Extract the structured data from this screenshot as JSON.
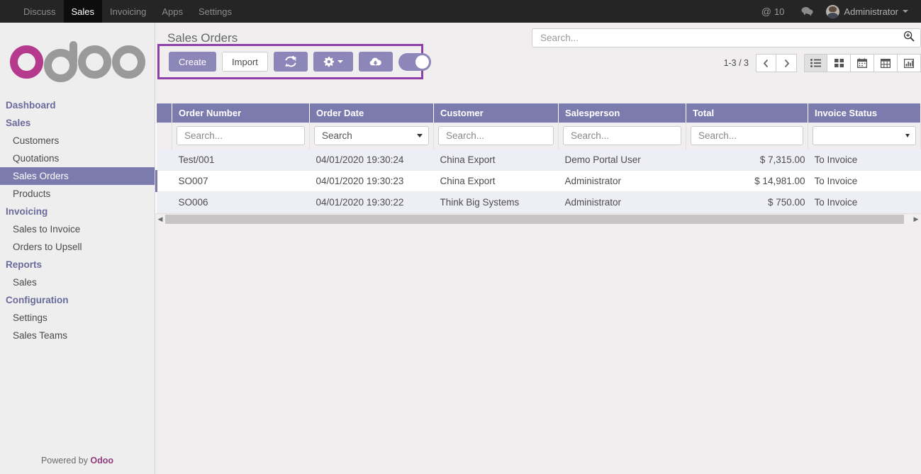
{
  "navbar": {
    "menus": [
      {
        "label": "Discuss",
        "active": false
      },
      {
        "label": "Sales",
        "active": true
      },
      {
        "label": "Invoicing",
        "active": false
      },
      {
        "label": "Apps",
        "active": false
      },
      {
        "label": "Settings",
        "active": false
      }
    ],
    "mention_symbol": "@",
    "mention_count": "10",
    "chat_icon": "chat-bubble-icon",
    "user_name": "Administrator",
    "avatar_icon": "user-avatar"
  },
  "sidebar": {
    "logo_text": "odoo",
    "logo_accent_color": "#b5398d",
    "logo_gray_color": "#9a9a9a",
    "sections": [
      {
        "heading": "Dashboard",
        "is_heading_only": true,
        "items": []
      },
      {
        "heading": "Sales",
        "items": [
          {
            "label": "Customers",
            "active": false
          },
          {
            "label": "Quotations",
            "active": false
          },
          {
            "label": "Sales Orders",
            "active": true
          },
          {
            "label": "Products",
            "active": false
          }
        ]
      },
      {
        "heading": "Invoicing",
        "items": [
          {
            "label": "Sales to Invoice",
            "active": false
          },
          {
            "label": "Orders to Upsell",
            "active": false
          }
        ]
      },
      {
        "heading": "Reports",
        "items": [
          {
            "label": "Sales",
            "active": false
          }
        ]
      },
      {
        "heading": "Configuration",
        "items": [
          {
            "label": "Settings",
            "active": false
          },
          {
            "label": "Sales Teams",
            "active": false
          }
        ]
      }
    ],
    "footer_prefix": "Powered by ",
    "footer_brand": "Odoo"
  },
  "control_panel": {
    "title": "Sales Orders",
    "highlight_color": "#8e3fa8",
    "buttons": [
      {
        "name": "create-button",
        "label": "Create",
        "style": "primary"
      },
      {
        "name": "import-button",
        "label": "Import",
        "style": "white"
      },
      {
        "name": "refresh-button",
        "icon": "refresh-icon",
        "style": "icon"
      },
      {
        "name": "settings-button",
        "icon": "gear-icon",
        "style": "icon-caret"
      },
      {
        "name": "download-button",
        "icon": "cloud-download-icon",
        "style": "icon"
      },
      {
        "name": "mode-toggle",
        "icon": "toggle-switch",
        "state": "on"
      }
    ],
    "search": {
      "placeholder": "Search...",
      "value": "",
      "icon": "search-zoom-in-icon"
    },
    "pager": "1-3 / 3",
    "prev_icon": "chevron-left-icon",
    "next_icon": "chevron-right-icon",
    "views": [
      {
        "name": "list-view-button",
        "icon": "list-icon",
        "active": true
      },
      {
        "name": "kanban-view-button",
        "icon": "kanban-icon",
        "active": false
      },
      {
        "name": "calendar-view-button",
        "icon": "calendar-icon",
        "active": false
      },
      {
        "name": "pivot-view-button",
        "icon": "pivot-table-icon",
        "active": false
      },
      {
        "name": "graph-view-button",
        "icon": "bar-chart-icon",
        "active": false
      }
    ]
  },
  "table": {
    "columns": [
      {
        "key": "order_number",
        "label": "Order Number",
        "filter_type": "input",
        "filter_placeholder": "Search...",
        "align": "left"
      },
      {
        "key": "order_date",
        "label": "Order Date",
        "filter_type": "select",
        "filter_value": "Search",
        "align": "left"
      },
      {
        "key": "customer",
        "label": "Customer",
        "filter_type": "input",
        "filter_placeholder": "Search...",
        "align": "left"
      },
      {
        "key": "salesperson",
        "label": "Salesperson",
        "filter_type": "input",
        "filter_placeholder": "Search...",
        "align": "left"
      },
      {
        "key": "total",
        "label": "Total",
        "filter_type": "input",
        "filter_placeholder": "Search...",
        "align": "right"
      },
      {
        "key": "invoice_status",
        "label": "Invoice Status",
        "filter_type": "select",
        "filter_value": "",
        "align": "left"
      }
    ],
    "rows": [
      {
        "order_number": "Test/001",
        "order_date": "04/01/2020 19:30:24",
        "customer": "China Export",
        "salesperson": "Demo Portal User",
        "total": "$ 7,315.00",
        "invoice_status": "To Invoice"
      },
      {
        "order_number": "SO007",
        "order_date": "04/01/2020 19:30:23",
        "customer": "China Export",
        "salesperson": "Administrator",
        "total": "$ 14,981.00",
        "invoice_status": "To Invoice"
      },
      {
        "order_number": "SO006",
        "order_date": "04/01/2020 19:30:22",
        "customer": "Think Big Systems",
        "salesperson": "Administrator",
        "total": "$ 750.00",
        "invoice_status": "To Invoice"
      }
    ],
    "scrollbar": {
      "left_arrow": "◀",
      "right_arrow": "▶"
    }
  }
}
